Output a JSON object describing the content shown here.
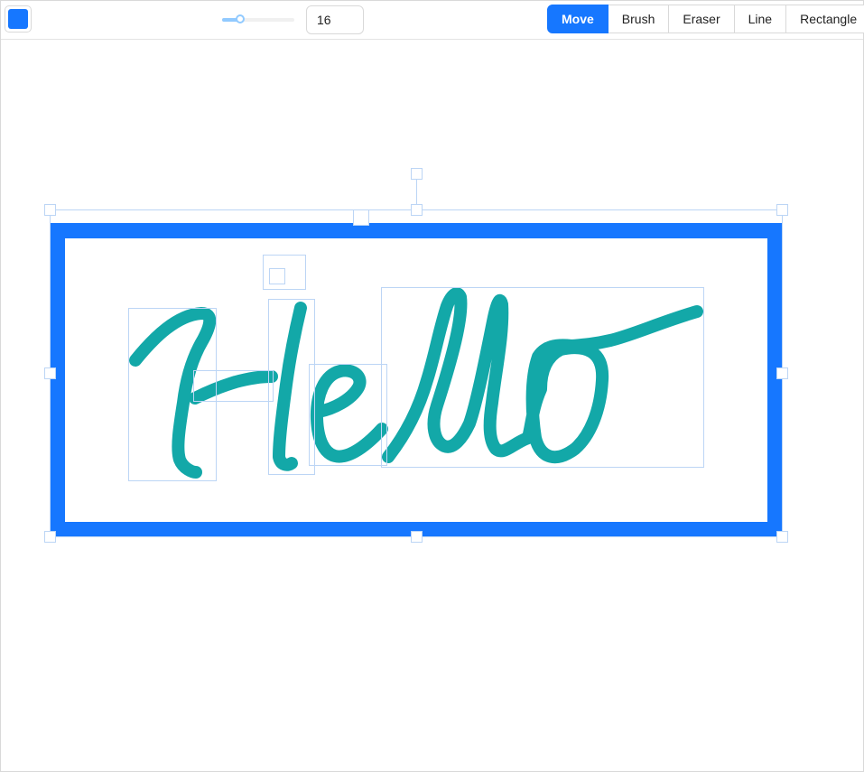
{
  "toolbar": {
    "color": {
      "value": "#1677ff"
    },
    "brush_size": {
      "slider_value": 16,
      "slider_min": 0,
      "slider_max": 64,
      "input_value": "16"
    },
    "tools": [
      {
        "label": "Move",
        "active": true
      },
      {
        "label": "Brush",
        "active": false
      },
      {
        "label": "Eraser",
        "active": false
      },
      {
        "label": "Line",
        "active": false
      },
      {
        "label": "Rectangle",
        "active": false
      }
    ]
  },
  "canvas": {
    "rectangle_color": "#1677ff",
    "stroke_color": "#13a8a8",
    "selection_color": "#bcd5f5",
    "shapes": [
      "rectangle",
      "H-stroke-1",
      "H-stroke-2",
      "H-stroke-3",
      "e-stroke",
      "l-l-o-stroke"
    ],
    "selected": "all"
  }
}
